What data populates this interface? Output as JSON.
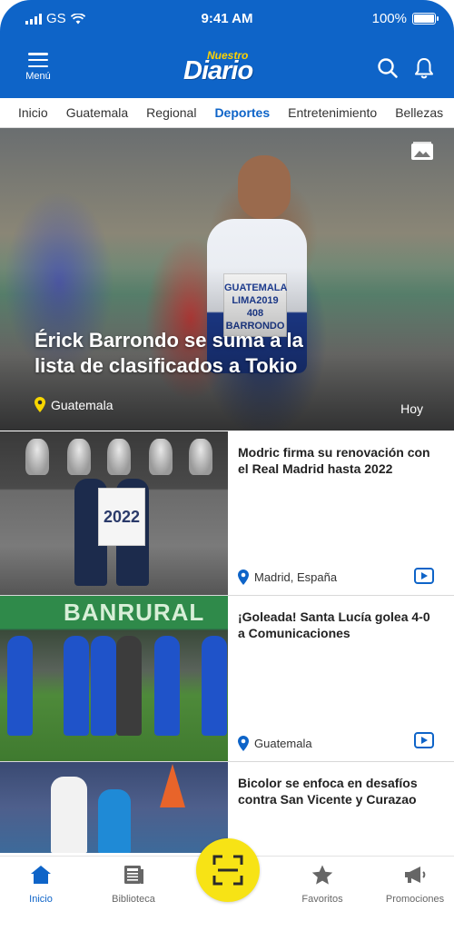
{
  "status_bar": {
    "carrier": "GS",
    "time": "9:41 AM",
    "battery": "100%"
  },
  "app_bar": {
    "menu_label": "Menú",
    "logo_top": "Nuestro",
    "logo_main": "Diario",
    "search_icon": "search-icon",
    "bell_icon": "bell-icon"
  },
  "nav_tabs": [
    "Inicio",
    "Guatemala",
    "Regional",
    "Deportes",
    "Entretenimiento",
    "Bellezas"
  ],
  "active_tab": "Deportes",
  "hero": {
    "headline": "Érick Barrondo se suma a la lista de clasificados a Tokio",
    "location": "Guatemala",
    "date": "Hoy",
    "bib_text": "GUATEMALA\nLIMA2019\n408\nBARRONDO"
  },
  "articles": [
    {
      "title": "Modric firma su renovación con el Real Madrid hasta 2022",
      "location": "Madrid, España",
      "has_video": true,
      "shirt_text": "2022"
    },
    {
      "title": "¡Goleada! Santa Lucía golea 4-0 a Comunicaciones",
      "location": "Guatemala",
      "has_video": true,
      "banner_text": "BANRURAL"
    },
    {
      "title": "Bicolor se enfoca en desafíos contra San Vicente y Curazao",
      "location": "",
      "has_video": false
    }
  ],
  "bottom_nav": {
    "items": [
      {
        "label": "Inicio",
        "icon": "home-icon"
      },
      {
        "label": "Biblioteca",
        "icon": "newspaper-icon"
      },
      {
        "label": "Favoritos",
        "icon": "star-icon"
      },
      {
        "label": "Promociones",
        "icon": "megaphone-icon"
      }
    ],
    "scan_icon": "scan-icon"
  },
  "colors": {
    "brand_blue": "#0e64c8",
    "logo_yellow": "#ffd200",
    "scan_yellow": "#f7e315"
  }
}
